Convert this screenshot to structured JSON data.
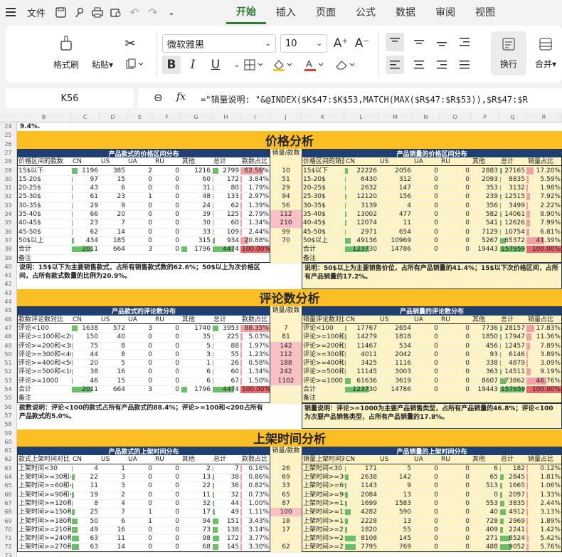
{
  "menubar": {
    "file_label": "文件",
    "tabs": [
      "开始",
      "插入",
      "页面",
      "公式",
      "数据",
      "审阅",
      "视图"
    ],
    "active_tab": "开始"
  },
  "ribbon": {
    "format_painter": "格式刷",
    "paste": "粘贴",
    "font_name": "微软雅黑",
    "font_size": "10",
    "wrap": "换行",
    "merge": "合并"
  },
  "formula_bar": {
    "cell_ref": "K56",
    "fx": "fx",
    "formula": "=\"销量说明: \"&@INDEX($K$47:$K$53,MATCH(MAX($R$47:$R$53)),$R$47:$R"
  },
  "columns": [
    "K",
    "B",
    "C",
    "D",
    "E",
    "F",
    "G",
    "H",
    "I",
    "J",
    "K",
    "L",
    "M",
    "N",
    "O",
    "P",
    "Q",
    "R"
  ],
  "rows": [
    "24",
    "25",
    "26",
    "27",
    "28",
    "29",
    "30",
    "31",
    "32",
    "33",
    "34",
    "35",
    "36",
    "37",
    "38",
    "39",
    "40",
    "41",
    "42",
    "43",
    "44",
    "45",
    "46",
    "47",
    "48",
    "49",
    "50",
    "51",
    "52",
    "53",
    "54",
    "55",
    "56",
    "57",
    "58",
    "59",
    "60",
    "61",
    "62",
    "63",
    "64",
    "65",
    "66",
    "67",
    "68",
    "69",
    "70",
    "71",
    "72",
    "73"
  ],
  "row24_text": "9.4%.",
  "sections": {
    "price": "价格分析",
    "review": "评论数分析",
    "listing": "上架时间分析"
  },
  "price": {
    "left_title": "产品款式的价格区间分布",
    "right_title": "产品销量的价格区间分布",
    "mid_header": "销量/款数",
    "left_headers": [
      "价格区间的款数",
      "CN",
      "US",
      "UA",
      "RU",
      "其他",
      "总计",
      "款数占比"
    ],
    "right_headers": [
      "价格区间的销量",
      "CN",
      "US",
      "UA",
      "RU",
      "其他",
      "总计",
      "销量占比"
    ],
    "left_rows": [
      [
        "15$以下",
        "1196",
        "385",
        "2",
        "0",
        "1216",
        "2799",
        "62.56%"
      ],
      [
        "15-20$",
        "97",
        "15",
        "0",
        "0",
        "60",
        "172",
        "3.84%"
      ],
      [
        "20-25$",
        "43",
        "6",
        "0",
        "0",
        "31",
        "80",
        "1.79%"
      ],
      [
        "25-30$",
        "61",
        "23",
        "1",
        "0",
        "48",
        "133",
        "2.97%"
      ],
      [
        "30-35$",
        "29",
        "9",
        "0",
        "0",
        "24",
        "62",
        "1.39%"
      ],
      [
        "35-40$",
        "66",
        "20",
        "0",
        "0",
        "39",
        "125",
        "2.79%"
      ],
      [
        "40-45$",
        "23",
        "7",
        "0",
        "0",
        "30",
        "60",
        "1.34%"
      ],
      [
        "45-50$",
        "62",
        "14",
        "0",
        "0",
        "33",
        "109",
        "2.44%"
      ],
      [
        "50$以上",
        "434",
        "185",
        "0",
        "0",
        "315",
        "934",
        "20.88%"
      ],
      [
        "合计",
        "2011",
        "664",
        "3",
        "0",
        "1796",
        "4474",
        "100.00%"
      ],
      [
        "备注",
        "",
        "",
        "",
        "",
        "",
        "",
        ""
      ]
    ],
    "mid": [
      "10",
      "51",
      "29",
      "94",
      "56",
      "112",
      "210",
      "99",
      "70",
      "",
      ""
    ],
    "right_rows": [
      [
        "15$以下",
        "22226",
        "2056",
        "0",
        "0",
        "2883",
        "27165",
        "17.20%"
      ],
      [
        "15-20$",
        "6430",
        "312",
        "0",
        "0",
        "2093",
        "8835",
        "5.59%"
      ],
      [
        "20-25$",
        "2632",
        "147",
        "0",
        "0",
        "353",
        "3132",
        "1.98%"
      ],
      [
        "25-30$",
        "12120",
        "156",
        "0",
        "0",
        "239",
        "12515",
        "7.92%"
      ],
      [
        "30-35$",
        "3139",
        "4",
        "0",
        "0",
        "356",
        "3499",
        "2.22%"
      ],
      [
        "35-40$",
        "13002",
        "477",
        "0",
        "0",
        "582",
        "14061",
        "8.90%"
      ],
      [
        "40-45$",
        "12074",
        "11",
        "0",
        "0",
        "541",
        "12626",
        "7.99%"
      ],
      [
        "45-50$",
        "2971",
        "654",
        "0",
        "0",
        "7129",
        "10754",
        "6.81%"
      ],
      [
        "50$以上",
        "49136",
        "10969",
        "0",
        "0",
        "5267",
        "65372",
        "41.39%"
      ],
      [
        "合计",
        "123730",
        "14786",
        "0",
        "0",
        "19443",
        "157959",
        "100.00%"
      ],
      [
        "备注",
        "",
        "",
        "",
        "",
        "",
        "",
        ""
      ]
    ],
    "left_note": "说明：15$以下为主要销售款式，占所有销售款式数的62.6%；50$以上为次价格区间，占所有款式数量的比例为20.9%。",
    "right_note": "说明：50$以上为主要销售价位，占所有产品销量的41.4%；15$以下次价格区间，占所有产品销量的17.2%。"
  },
  "review": {
    "left_title": "产品款式的评论数分布",
    "right_title": "产品销量的评论数分布",
    "mid_header": "销量/款数",
    "left_headers": [
      "款数评论数对比",
      "CN",
      "US",
      "UA",
      "RU",
      "其他",
      "总计",
      "款数占比"
    ],
    "right_headers": [
      "销量评论数对比",
      "CN",
      "US",
      "UA",
      "RU",
      "其他",
      "总计",
      "销量占比"
    ],
    "left_rows": [
      [
        "评论<100",
        "1638",
        "572",
        "3",
        "0",
        "1740",
        "3953",
        "88.35%"
      ],
      [
        "评论>=100和<200",
        "150",
        "40",
        "0",
        "0",
        "35",
        "225",
        "5.03%"
      ],
      [
        "评论>=200和<300",
        "75",
        "8",
        "0",
        "0",
        "5",
        "88",
        "1.97%"
      ],
      [
        "评论>=300和<400",
        "44",
        "8",
        "0",
        "0",
        "3",
        "55",
        "1.23%"
      ],
      [
        "评论>=400和<500",
        "20",
        "5",
        "0",
        "0",
        "1",
        "26",
        "0.58%"
      ],
      [
        "评论>=500和<1000",
        "38",
        "16",
        "0",
        "0",
        "6",
        "60",
        "1.34%"
      ],
      [
        "评论>=1000",
        "46",
        "15",
        "0",
        "0",
        "6",
        "67",
        "1.50%"
      ],
      [
        "合计",
        "2011",
        "664",
        "3",
        "0",
        "1796",
        "4474",
        "100.00%"
      ],
      [
        "备注",
        "",
        "",
        "",
        "",
        "",
        "",
        ""
      ]
    ],
    "mid": [
      "7",
      "81",
      "142",
      "112",
      "188",
      "242",
      "1102",
      "",
      ""
    ],
    "right_rows": [
      [
        "评论<100",
        "17767",
        "2654",
        "0",
        "0",
        "7736",
        "28157",
        "17.83%"
      ],
      [
        "评论>=100和<200",
        "14279",
        "1818",
        "0",
        "0",
        "1850",
        "17947",
        "11.36%"
      ],
      [
        "评论>=200和<300",
        "11467",
        "534",
        "0",
        "0",
        "456",
        "12457",
        "7.89%"
      ],
      [
        "评论>=300和<400",
        "4011",
        "2042",
        "0",
        "0",
        "93",
        "6146",
        "3.89%"
      ],
      [
        "评论>=400和<500",
        "3425",
        "1116",
        "0",
        "0",
        "338",
        "4879",
        "3.09%"
      ],
      [
        "评论>=500和<1000",
        "11145",
        "3003",
        "0",
        "0",
        "363",
        "14511",
        "9.19%"
      ],
      [
        "评论>=1000",
        "61636",
        "3619",
        "0",
        "0",
        "8607",
        "73862",
        "46.76%"
      ],
      [
        "合计",
        "123730",
        "14786",
        "0",
        "0",
        "19443",
        "157959",
        "100.00%"
      ],
      [
        "备注",
        "",
        "",
        "",
        "",
        "",
        "",
        ""
      ]
    ],
    "left_note": "款数说明：评论<100的款式占所有产品款式的88.4%；评论>=100和<200占所有产品款式的5.0%。",
    "right_note": "销量说明：评论>=1000为主要产品销售类型，占所有产品销量的46.8%；评论<100为次要产品销售类型，占所有产品销量的17.8%。"
  },
  "listing": {
    "left_title": "产品款式的上架时间分布",
    "right_title": "产品销量的上架时间分布",
    "mid_header": "销量/款数",
    "left_headers": [
      "款式上架时间对比",
      "CN",
      "US",
      "UA",
      "RU",
      "其他",
      "总计",
      "款数占比"
    ],
    "right_headers": [
      "销量上架时间对比",
      "CN",
      "US",
      "UA",
      "RU",
      "其他",
      "总计",
      "销量占比"
    ],
    "left_rows": [
      [
        "上架时间<30",
        "4",
        "1",
        "0",
        "0",
        "2",
        "7",
        "0.16%"
      ],
      [
        "上架时间>=30和<60",
        "22",
        "3",
        "0",
        "0",
        "13",
        "38",
        "0.86%"
      ],
      [
        "上架时间>=60和<90",
        "11",
        "3",
        "0",
        "0",
        "22",
        "36",
        "0.82%"
      ],
      [
        "上架时间>=90和<120",
        "19",
        "2",
        "0",
        "0",
        "11",
        "32",
        "0.73%"
      ],
      [
        "上架时间>=120和<150",
        "8",
        "4",
        "0",
        "0",
        "32",
        "44",
        "1.00%"
      ],
      [
        "上架时间>=150和<180",
        "25",
        "7",
        "1",
        "0",
        "17",
        "49",
        "1.11%"
      ],
      [
        "上架时间>=180和<210",
        "50",
        "6",
        "1",
        "0",
        "94",
        "151",
        "3.43%"
      ],
      [
        "上架时间>=210和<240",
        "49",
        "16",
        "0",
        "0",
        "73",
        "138",
        "3.14%"
      ],
      [
        "上架时间>=240和<270",
        "63",
        "11",
        "0",
        "0",
        "98",
        "172",
        "3.77%"
      ],
      [
        "上架时间>=270和<300",
        "63",
        "14",
        "0",
        "0",
        "68",
        "145",
        "3.30%"
      ]
    ],
    "mid": [
      "26",
      "69",
      "33",
      "65",
      "87",
      "100",
      "18",
      "17",
      "",
      "62"
    ],
    "right_rows": [
      [
        "上架时间<30",
        "171",
        "5",
        "0",
        "0",
        "6",
        "182",
        "0.12%"
      ],
      [
        "上架时间>=30和<60",
        "2638",
        "142",
        "0",
        "0",
        "65",
        "2845",
        "1.81%"
      ],
      [
        "上架时间>=60和<90",
        "1143",
        "9",
        "0",
        "0",
        "513",
        "1665",
        "1.06%"
      ],
      [
        "上架时间>=90和<120",
        "2084",
        "13",
        "0",
        "0",
        "0",
        "2097",
        "1.33%"
      ],
      [
        "上架时间>=120和<150",
        "1699",
        "1583",
        "0",
        "0",
        "553",
        "3835",
        "2.44%"
      ],
      [
        "上架时间>=150和<180",
        "4282",
        "590",
        "0",
        "0",
        "40",
        "4912",
        "3.13%"
      ],
      [
        "上架时间>=180和<210",
        "2228",
        "13",
        "0",
        "0",
        "728",
        "2969",
        "1.89%"
      ],
      [
        "上架时间>=210和<240",
        "1820",
        "55",
        "0",
        "0",
        "409",
        "2241",
        "1.42%"
      ],
      [
        "上架时间>=240和<270",
        "8108",
        "145",
        "0",
        "0",
        "271",
        "8524",
        "5.42%"
      ],
      [
        "上架时间>=270和<300",
        "7795",
        "769",
        "0",
        "0",
        "488",
        "9052",
        "5.76%"
      ]
    ]
  },
  "colors": {
    "accent_green": "#2e7d32",
    "band_yellow": "#fbbf24",
    "navy": "#1f3f73",
    "light_yellow": "#fdf3c4",
    "pink": "#f9c0c6",
    "light_blue": "#d6e4f5"
  }
}
